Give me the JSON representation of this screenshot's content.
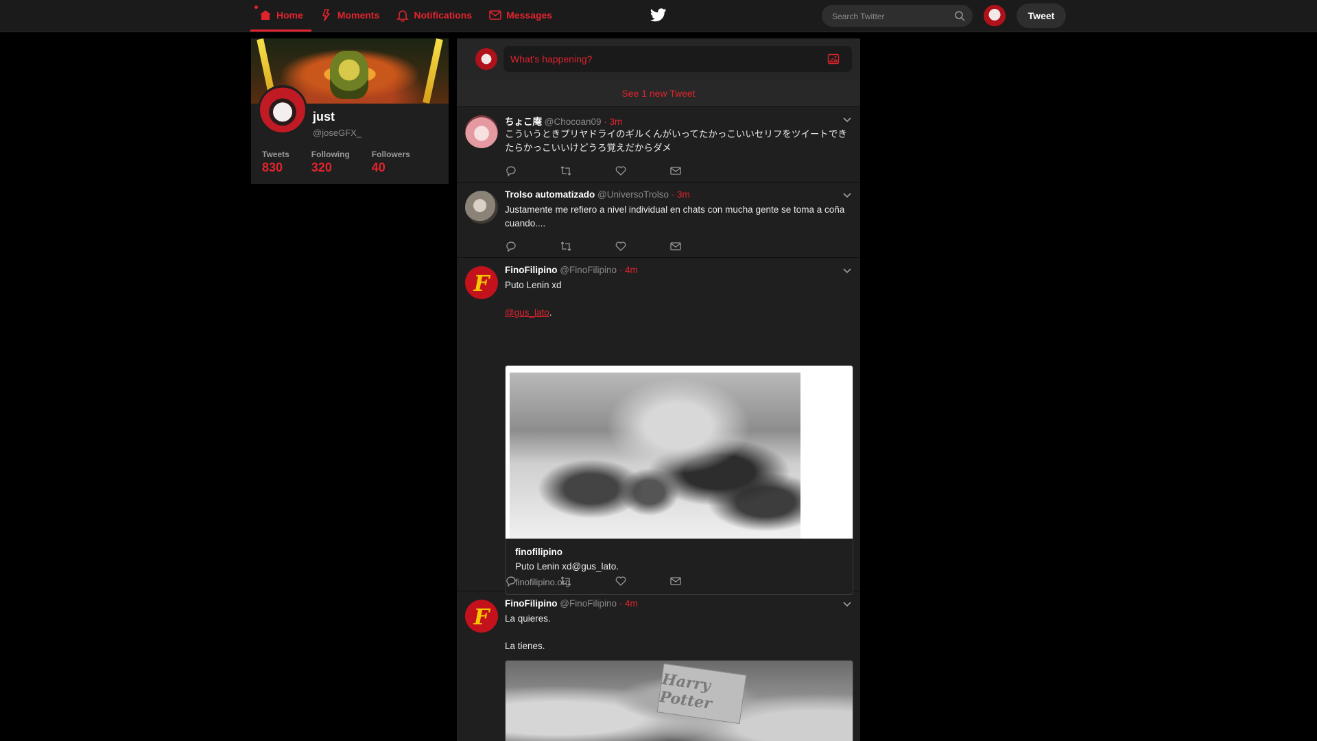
{
  "nav": {
    "items": [
      {
        "label": "Home",
        "icon": "home-icon",
        "active": true
      },
      {
        "label": "Moments",
        "icon": "lightning-icon",
        "active": false
      },
      {
        "label": "Notifications",
        "icon": "bell-icon",
        "active": false
      },
      {
        "label": "Messages",
        "icon": "envelope-icon",
        "active": false
      }
    ],
    "logo_icon": "twitter-bird-icon",
    "search_placeholder": "Search Twitter",
    "tweet_button": "Tweet",
    "accent_color": "#e0242e"
  },
  "profile": {
    "name": "just",
    "handle": "@joseGFX_",
    "stats": [
      {
        "label": "Tweets",
        "value": "830"
      },
      {
        "label": "Following",
        "value": "320"
      },
      {
        "label": "Followers",
        "value": "40"
      }
    ]
  },
  "composer": {
    "placeholder": "What's happening?"
  },
  "new_tweets_bar": "See 1 new Tweet",
  "tweets": [
    {
      "name": "ちょこ庵",
      "handle": "@Chocoan09",
      "time": "· 3m",
      "text": "こういうときプリヤドライのギルくんがいってたかっこいいセリフをツイートできたらかっこいいけどうろ覚えだからダメ"
    },
    {
      "name": "Trolso automatizado",
      "handle": "@UniversoTrolso",
      "time": "· 3m",
      "text": "Justamente me refiero a nivel individual en chats con mucha gente se toma a coña cuando...."
    },
    {
      "name": "FinoFilipino",
      "handle": "@FinoFilipino",
      "time": "· 4m",
      "text_line1": "Puto Lenin xd",
      "mention": "@gus_lato",
      "mention_suffix": ".",
      "card": {
        "title": "finofilipino",
        "description": "Puto Lenin xd@gus_lato.",
        "url": "finofilipino.org"
      }
    },
    {
      "name": "FinoFilipino",
      "handle": "@FinoFilipino",
      "time": "· 4m",
      "text_line1": "La quieres.",
      "text_line2": "La tienes.",
      "media_text": "Harry Potter"
    }
  ]
}
